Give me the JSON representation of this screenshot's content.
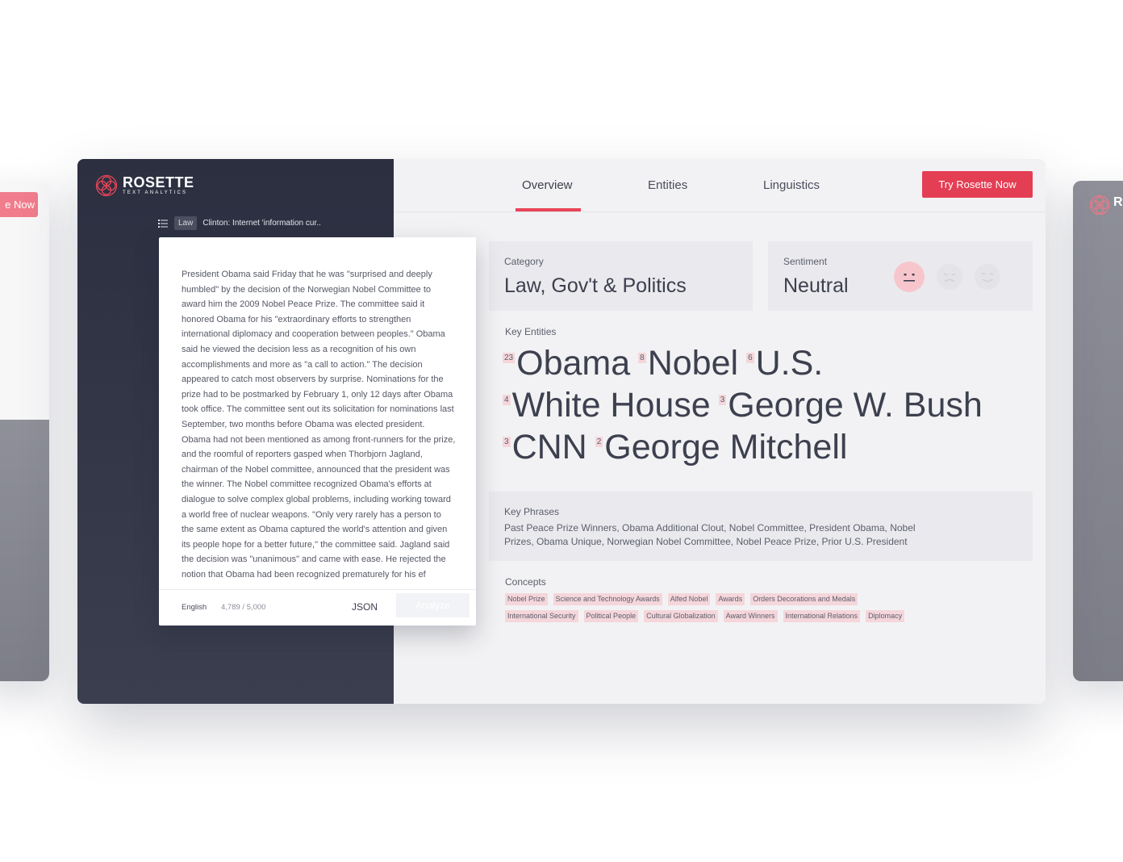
{
  "left_card": {
    "cta_label": "e Now"
  },
  "right_card": {
    "logo_text": "R"
  },
  "brand": {
    "name": "ROSETTE",
    "tagline": "TEXT ANALYTICS",
    "accent": "#e43e54"
  },
  "breadcrumb": {
    "category": "Law",
    "title": "Clinton: Internet 'information cur.."
  },
  "document": {
    "text": "President Obama said Friday that he was \"surprised and deeply humbled\" by the decision of the Norwegian Nobel Committee to award him the 2009 Nobel Peace Prize. The committee said it honored Obama for his \"extraordinary efforts to strengthen international diplomacy and cooperation between peoples.\" Obama said he viewed the decision less as a recognition of his own accomplishments and more as \"a call to action.\" The decision appeared to catch most observers by surprise. Nominations for the prize had to be postmarked by February 1, only 12 days after Obama took office. The committee sent out its solicitation for nominations last September, two months before Obama was elected president. Obama had not been mentioned as among front-runners for the prize, and the roomful of reporters gasped when Thorbjorn Jagland, chairman of the Nobel committee, announced that the president was the winner. The Nobel committee recognized Obama's efforts at dialogue to solve complex global problems, including working toward a world free of nuclear weapons. \"Only very rarely has a person to the same extent as Obama captured the world's attention and given its people hope for a better future,\" the committee said. Jagland said the decision was \"unanimous\" and came with ease. He rejected the notion that Obama had been recognized prematurely for his ef",
    "language": "English",
    "char_count": "4,789 / 5,000",
    "json_label": "JSON",
    "analyze_label": "Analyze"
  },
  "nav": {
    "tabs": [
      {
        "label": "Overview",
        "active": true
      },
      {
        "label": "Entities",
        "active": false
      },
      {
        "label": "Linguistics",
        "active": false
      }
    ],
    "cta_label": "Try Rosette Now"
  },
  "category": {
    "label": "Category",
    "value": "Law, Gov't & Politics"
  },
  "sentiment": {
    "label": "Sentiment",
    "value": "Neutral"
  },
  "key_entities": {
    "label": "Key Entities",
    "lines": [
      [
        {
          "count": "23",
          "name": "Obama"
        },
        {
          "count": "8",
          "name": "Nobel"
        },
        {
          "count": "6",
          "name": "U.S."
        }
      ],
      [
        {
          "count": "4",
          "name": "White House"
        },
        {
          "count": "3",
          "name": "George W. Bush"
        }
      ],
      [
        {
          "count": "3",
          "name": "CNN"
        },
        {
          "count": "2",
          "name": "George Mitchell"
        }
      ]
    ]
  },
  "key_phrases": {
    "label": "Key Phrases",
    "text": "Past Peace Prize Winners, Obama Additional Clout, Nobel Committee, President Obama, Nobel Prizes, Obama Unique, Norwegian Nobel Committee, Nobel Peace Prize, Prior U.S. President"
  },
  "concepts": {
    "label": "Concepts",
    "rows": [
      [
        "Nobel Prize",
        "Science and Technology Awards",
        "Alfed Nobel",
        "Awards",
        "Orders Decorations and Medals"
      ],
      [
        "International Security",
        "Political People",
        "Cultural Globalization",
        "Award Winners",
        "International Relations",
        "Diplomacy"
      ]
    ]
  }
}
